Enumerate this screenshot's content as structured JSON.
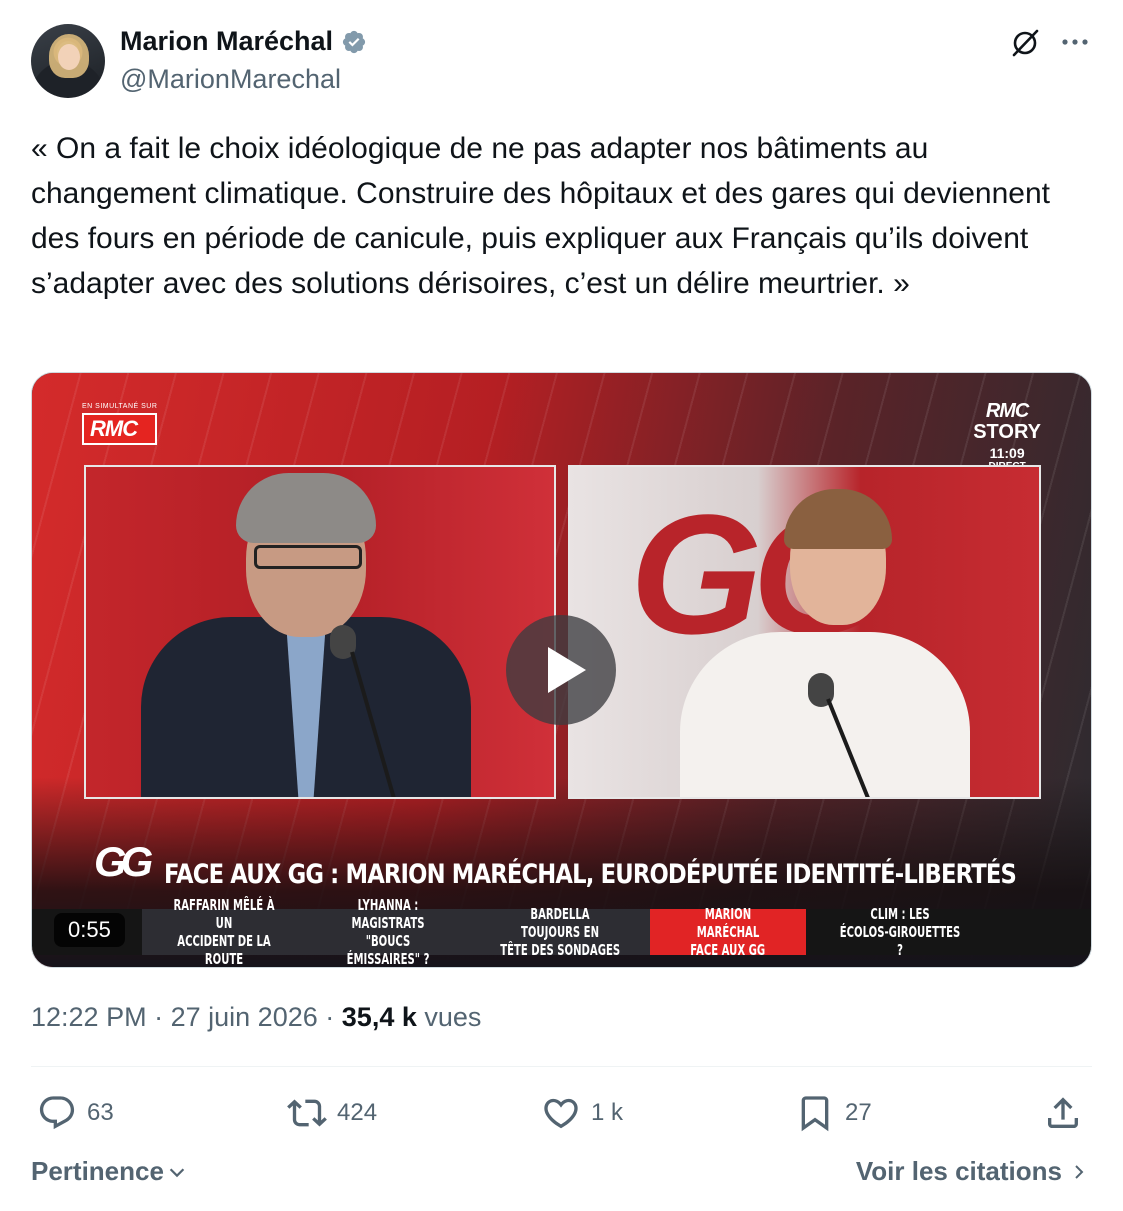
{
  "author": {
    "name": "Marion Maréchal",
    "handle": "@MarionMarechal",
    "verified_color": "#829aab"
  },
  "header_icons": [
    "grok-icon",
    "more-icon"
  ],
  "tweet": {
    "text": "« On a fait le choix idéologique de ne pas adapter nos bâtiments au changement climatique. Construire des hôpitaux et des gares qui deviennent des fours en période de canicule, puis expliquer aux Français qu’ils doivent s’adapter avec des solutions dérisoires, c’est un délire meurtrier. »"
  },
  "video": {
    "simulcast_label": "EN SIMULTANÉ SUR",
    "rmc_logo": "RMC",
    "channel": {
      "line1": "RMC",
      "line2": "STORY",
      "time": "11:09",
      "live": "DIRECT"
    },
    "panel_letters": "GG",
    "badge": "GG",
    "headline": "FACE AUX GG : MARION MARÉCHAL, EURODÉPUTÉE IDENTITÉ-LIBERTÉS",
    "ticker": [
      {
        "line1": "RAFFARIN MÊLÉ À UN",
        "line2": "ACCIDENT DE LA ROUTE"
      },
      {
        "line1": "LYHANNA : MAGISTRATS",
        "line2": "\"BOUCS ÉMISSAIRES\" ?"
      },
      {
        "line1": "BARDELLA TOUJOURS EN",
        "line2": "TÊTE DES SONDAGES"
      },
      {
        "line1": "MARION MARÉCHAL",
        "line2": "FACE AUX GG"
      },
      {
        "line1": "CLIM : LES",
        "line2": "ÉCOLOS-GIROUETTES ?"
      }
    ],
    "duration": "0:55"
  },
  "meta": {
    "time": "12:22 PM",
    "date": "27 juin 2026",
    "separator": "·",
    "views_count": "35,4 k",
    "views_label": "vues"
  },
  "actions": {
    "replies": "63",
    "reposts": "424",
    "likes": "1 k",
    "bookmarks": "27"
  },
  "footer": {
    "sort_label": "Pertinence",
    "quotes_label": "Voir les citations"
  },
  "colors": {
    "text_primary": "#0f1419",
    "text_secondary": "#536471",
    "ticker_highlight": "#e12425"
  }
}
